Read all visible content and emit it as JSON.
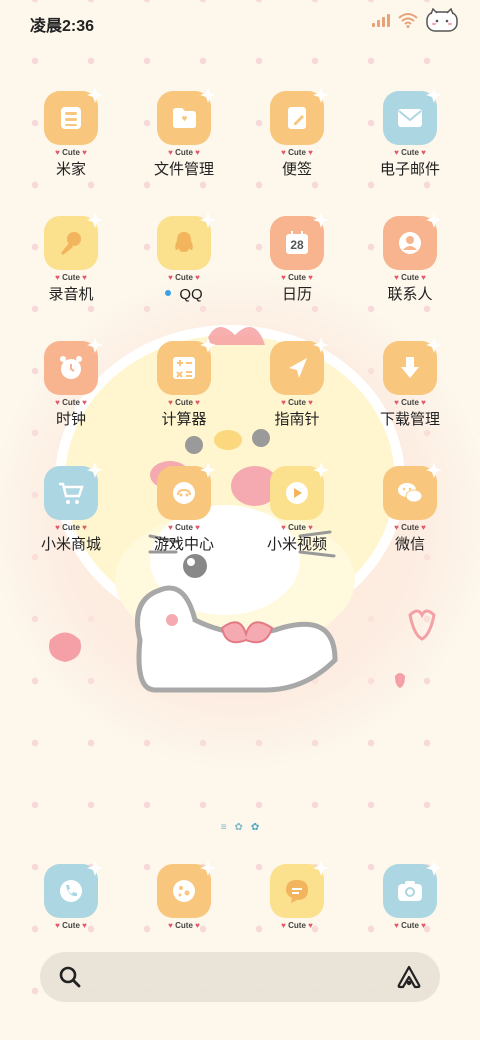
{
  "status_bar": {
    "time": "凌晨2:36"
  },
  "apps": [
    {
      "label": "米家",
      "icon": "mijia-icon",
      "color": "#f8c77d",
      "tag": "Cute"
    },
    {
      "label": "文件管理",
      "icon": "folder-icon",
      "color": "#f8c77d",
      "tag": "Cute"
    },
    {
      "label": "便签",
      "icon": "notes-icon",
      "color": "#f8c77d",
      "tag": "Cute"
    },
    {
      "label": "电子邮件",
      "icon": "mail-icon",
      "color": "#acd6e2",
      "tag": "Cute"
    },
    {
      "label": "录音机",
      "icon": "microphone-icon",
      "color": "#fbe08e",
      "tag": "Cute"
    },
    {
      "label": "QQ",
      "icon": "qq-penguin-icon",
      "color": "#fbe08e",
      "tag": "Cute"
    },
    {
      "label": "日历",
      "icon": "calendar-icon",
      "color": "#f7b48e",
      "tag": "Cute",
      "calendar_day": "28"
    },
    {
      "label": "联系人",
      "icon": "contacts-icon",
      "color": "#f7b48e",
      "tag": "Cute"
    },
    {
      "label": "时钟",
      "icon": "alarm-clock-icon",
      "color": "#f7b48e",
      "tag": "Cute"
    },
    {
      "label": "计算器",
      "icon": "calculator-icon",
      "color": "#f8c77d",
      "tag": "Cute"
    },
    {
      "label": "指南针",
      "icon": "compass-icon",
      "color": "#f8c77d",
      "tag": "Cute"
    },
    {
      "label": "下载管理",
      "icon": "download-icon",
      "color": "#f8c77d",
      "tag": "Cute"
    },
    {
      "label": "小米商城",
      "icon": "shopping-cart-icon",
      "color": "#acd6e2",
      "tag": "Cute"
    },
    {
      "label": "游戏中心",
      "icon": "gamepad-icon",
      "color": "#f8c77d",
      "tag": "Cute"
    },
    {
      "label": "小米视频",
      "icon": "video-play-icon",
      "color": "#fbe08e",
      "tag": "Cute"
    },
    {
      "label": "微信",
      "icon": "wechat-icon",
      "color": "#f8c77d",
      "tag": "Cute"
    }
  ],
  "dock": [
    {
      "icon": "phone-icon",
      "color": "#acd6e2",
      "tag": "Cute"
    },
    {
      "icon": "browser-icon",
      "color": "#f8c77d",
      "tag": "Cute"
    },
    {
      "icon": "messages-icon",
      "color": "#fbe08e",
      "tag": "Cute"
    },
    {
      "icon": "camera-icon",
      "color": "#acd6e2",
      "tag": "Cute"
    }
  ],
  "page_indicator": {
    "pages": 3,
    "current": 3
  }
}
